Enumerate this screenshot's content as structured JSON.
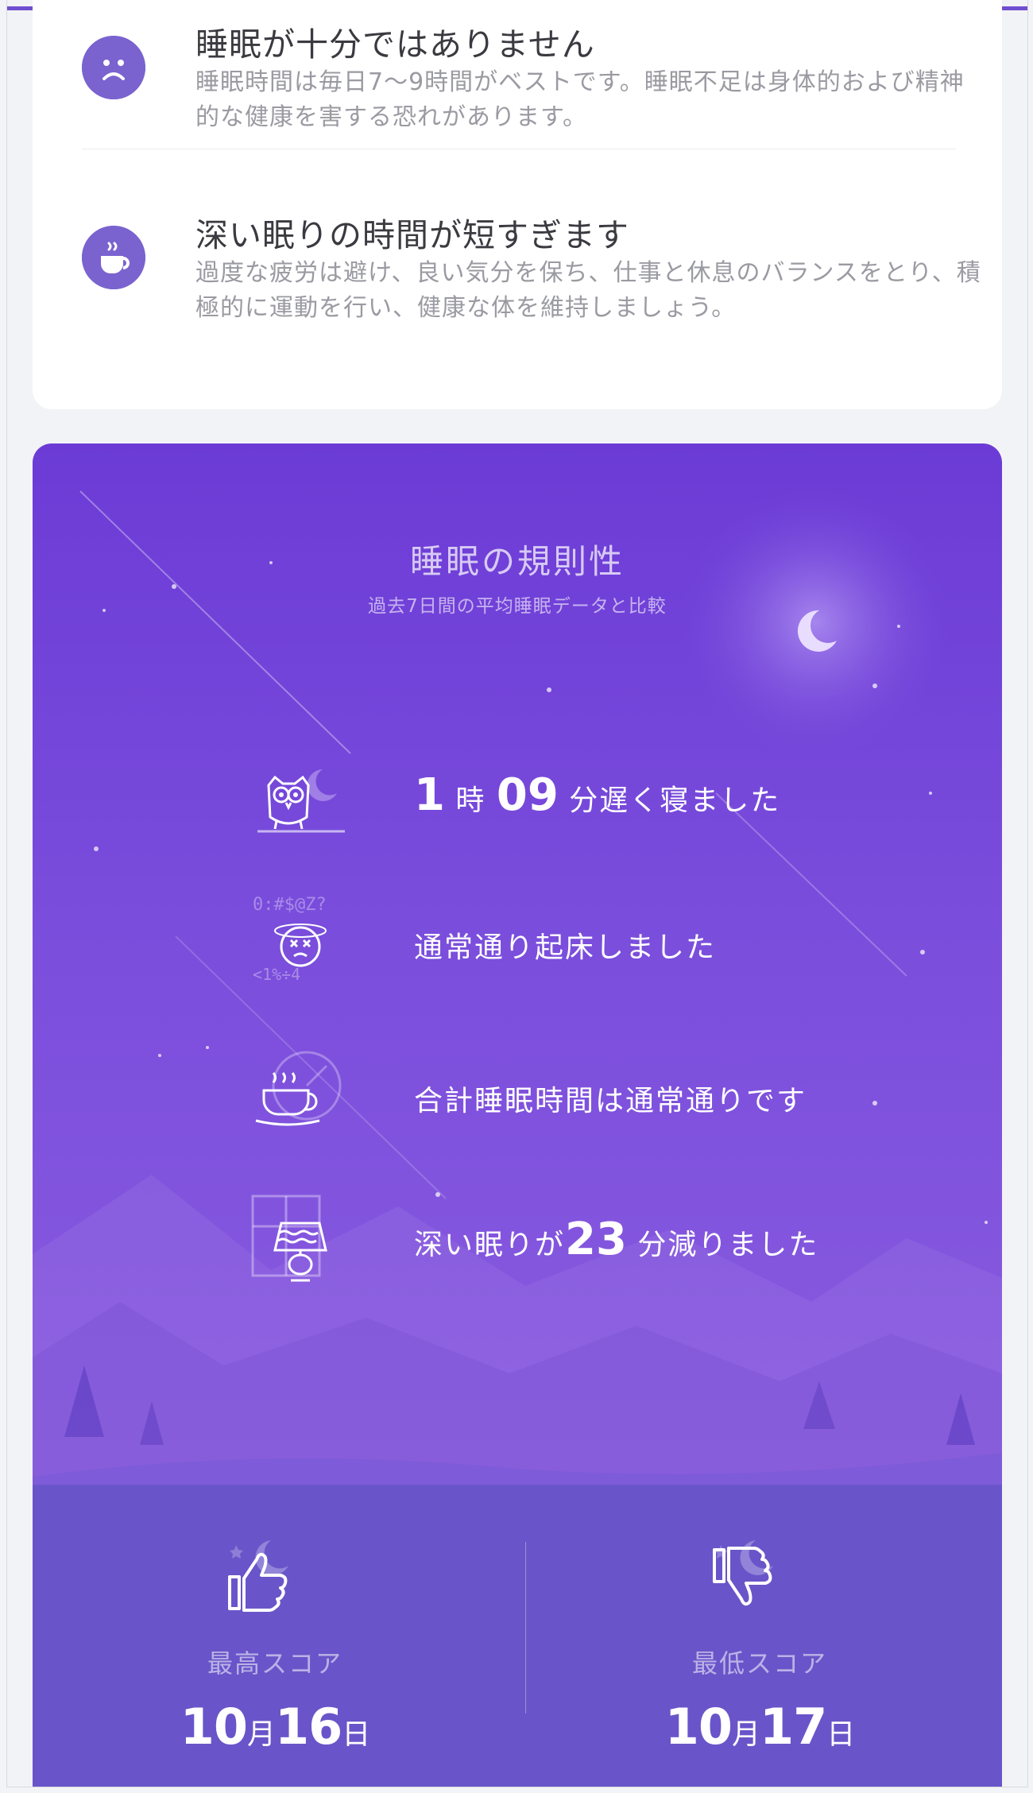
{
  "advice": [
    {
      "icon": "sad-face-icon",
      "title": "睡眠が十分ではありません",
      "description": "睡眠時間は毎日7〜9時間がベストです。睡眠不足は身体的および精神的な健康を害する恐れがあります。"
    },
    {
      "icon": "coffee-cup-icon",
      "title": "深い眠りの時間が短すぎます",
      "description": "過度な疲労は避け、良い気分を保ち、仕事と休息のバランスをとり、積極的に運動を行い、健康な体を維持しましょう。"
    }
  ],
  "regularity": {
    "title": "睡眠の規則性",
    "subtitle": "過去7日間の平均睡眠データと比較",
    "bedtime": {
      "hours": "1",
      "hour_unit": "時",
      "minutes": "09",
      "suffix": "分遅く寝ました",
      "icon": "owl-icon"
    },
    "wakeup": {
      "text": "通常通り起床しました",
      "icon": "dizzy-face-icon"
    },
    "total": {
      "text": "合計睡眠時間は通常通りです",
      "icon": "tea-clock-icon"
    },
    "deep": {
      "prefix": "深い眠りが",
      "minutes": "23",
      "suffix": "分減りました",
      "icon": "lamp-window-icon"
    }
  },
  "scores": {
    "best": {
      "label": "最高スコア",
      "month": "10",
      "month_unit": "月",
      "day": "16",
      "day_unit": "日",
      "icon": "thumbs-up-icon"
    },
    "worst": {
      "label": "最低スコア",
      "month": "10",
      "month_unit": "月",
      "day": "17",
      "day_unit": "日",
      "icon": "thumbs-down-icon"
    }
  },
  "colors": {
    "accent": "#6f4fd0",
    "card_purple": "#7a4ddc",
    "score_panel": "#6955c9",
    "icon_circle": "#7a62cf"
  }
}
